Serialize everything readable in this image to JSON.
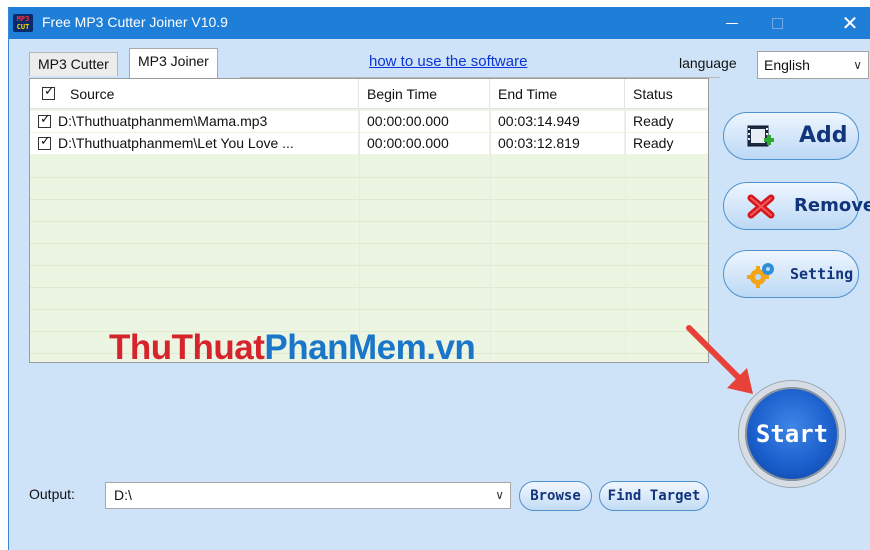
{
  "window": {
    "title": "Free MP3 Cutter Joiner V10.9",
    "logo_top": "MP3",
    "logo_bottom": "CUT",
    "min_glyph": "—",
    "close_glyph": "✕"
  },
  "tabs": [
    {
      "label": "MP3 Cutter",
      "active": false
    },
    {
      "label": "MP3 Joiner",
      "active": true
    }
  ],
  "help_link": "how to use the software",
  "language": {
    "label": "language",
    "selected": "English",
    "chevron": "∨"
  },
  "list": {
    "header_checked": true,
    "columns": [
      "Source",
      "Begin Time",
      "End Time",
      "Status"
    ],
    "rows": [
      {
        "checked": true,
        "source": "D:\\Thuthuatphanmem\\Mama.mp3",
        "begin": "00:00:00.000",
        "end": "00:03:14.949",
        "status": "Ready"
      },
      {
        "checked": true,
        "source": "D:\\Thuthuatphanmem\\Let You Love ...",
        "begin": "00:00:00.000",
        "end": "00:03:12.819",
        "status": "Ready"
      }
    ]
  },
  "watermark": {
    "part1": "ThuThuat",
    "part2": "PhanMem.vn"
  },
  "buttons": {
    "add": "Add",
    "remove": "Remove",
    "setting": "Setting",
    "start": "Start",
    "browse": "Browse",
    "find_target": "Find Target"
  },
  "output": {
    "label": "Output:",
    "value": "D:\\",
    "chevron": "∨"
  },
  "colors": {
    "titlebar": "#1f7fd8",
    "window_bg": "#cfe3f8",
    "list_bg": "#ecf5e2",
    "annotation_arrow": "#e8413a"
  }
}
